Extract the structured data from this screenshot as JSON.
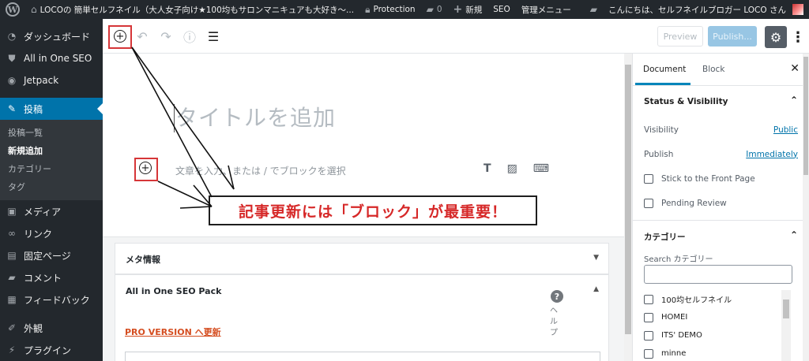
{
  "adminbar": {
    "site_title": "LOCOの 簡単セルフネイル（大人女子向け★100均もサロンマニキュアも大好き〜...",
    "protection": "Protection",
    "comments_count": "0",
    "new_label": "新規",
    "seo_label": "SEO",
    "admin_menu": "管理メニュー",
    "greeting": "こんにちは、セルフネイルブロガー LOCO さん"
  },
  "sidebar": {
    "items": [
      {
        "label": "ダッシュボード",
        "icon": "dashboard-icon"
      },
      {
        "label": "All in One SEO",
        "icon": "shield-icon"
      },
      {
        "label": "Jetpack",
        "icon": "jetpack-icon"
      },
      {
        "label": "投稿",
        "icon": "pin-icon"
      }
    ],
    "submenu": [
      "投稿一覧",
      "新規追加",
      "カテゴリー",
      "タグ"
    ],
    "items_after": [
      {
        "label": "メディア",
        "icon": "media-icon"
      },
      {
        "label": "リンク",
        "icon": "link-icon"
      },
      {
        "label": "固定ページ",
        "icon": "page-icon"
      },
      {
        "label": "コメント",
        "icon": "comment-icon"
      },
      {
        "label": "フィードバック",
        "icon": "feedback-icon"
      },
      {
        "label": "外観",
        "icon": "brush-icon"
      },
      {
        "label": "プラグイン",
        "icon": "plugin-icon"
      }
    ]
  },
  "toolbar": {
    "preview_label": "Preview",
    "publish_label": "Publish..."
  },
  "editor": {
    "title_placeholder": "タイトルを追加",
    "paragraph_placeholder": "文章を入力、または / でブロックを選択",
    "callout": "記事更新には「ブロック」が最重要！"
  },
  "metaboxes": {
    "meta_info": "メタ情報",
    "aioseo": "All in One SEO Pack",
    "help_label": "ヘルプ",
    "pro_link": "PRO VERSION へ更新"
  },
  "settings": {
    "tab_document": "Document",
    "tab_block": "Block",
    "status_heading": "Status & Visibility",
    "visibility_label": "Visibility",
    "visibility_value": "Public",
    "publish_label": "Publish",
    "publish_value": "Immediately",
    "stick_label": "Stick to the Front Page",
    "pending_label": "Pending Review",
    "category_heading": "カテゴリー",
    "search_label": "Search カテゴリー",
    "categories": [
      "100均セルフネイル",
      "HOMEI",
      "ITS' DEMO",
      "minne"
    ]
  },
  "colors": {
    "admin_dark": "#23282d",
    "accent": "#0073aa",
    "annotation_red": "#d63638",
    "callout_text": "#d62828"
  }
}
